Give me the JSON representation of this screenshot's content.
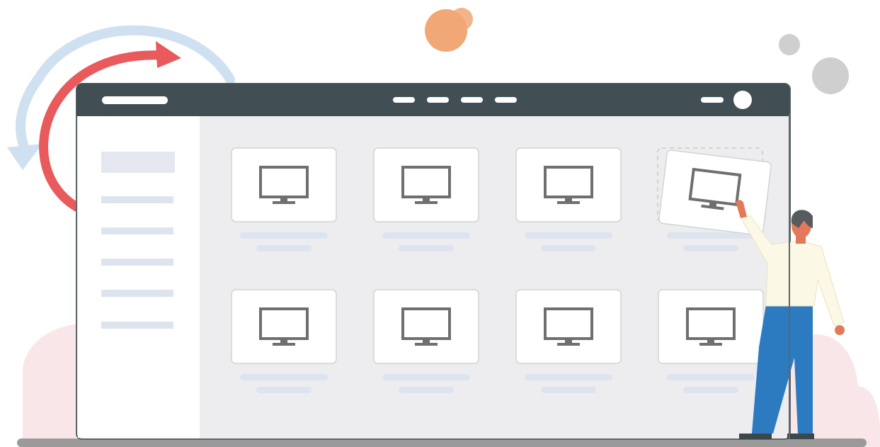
{
  "illustration": {
    "app_window": {
      "topbar": {
        "nav_pill_count": 4,
        "has_avatar": true
      },
      "sidebar": {
        "selected_items": 1,
        "line_items": 5
      },
      "grid": {
        "rows": 2,
        "columns": 4,
        "tile_icon": "monitor-icon",
        "tile_caption_lines": 2,
        "lifted_tile": {
          "row": 1,
          "column": 4
        }
      }
    },
    "refresh_arrows": [
      "red-arrow-icon",
      "blue-arrow-icon"
    ],
    "person": {
      "action": "placing-tile"
    },
    "colors": {
      "topbar": "#414f55",
      "content_bg": "#ededef",
      "sidebar_bg": "#ffffff",
      "tile_bg": "#ffffff",
      "placeholder_line": "#dde4ef",
      "monitor_icon": "#6f6f6f",
      "red_arrow": "#e85a5c",
      "blue_arrow": "#cfe0f1",
      "orange_circle": "#f2a776",
      "gray_circle": "#cfcfcf",
      "pink_cloud": "#f9e6e9",
      "floor": "#9a9a9a",
      "shirt": "#fcf8e6",
      "pants": "#2c7bc1",
      "skin": "#e4785a",
      "hair": "#555b5f"
    }
  }
}
